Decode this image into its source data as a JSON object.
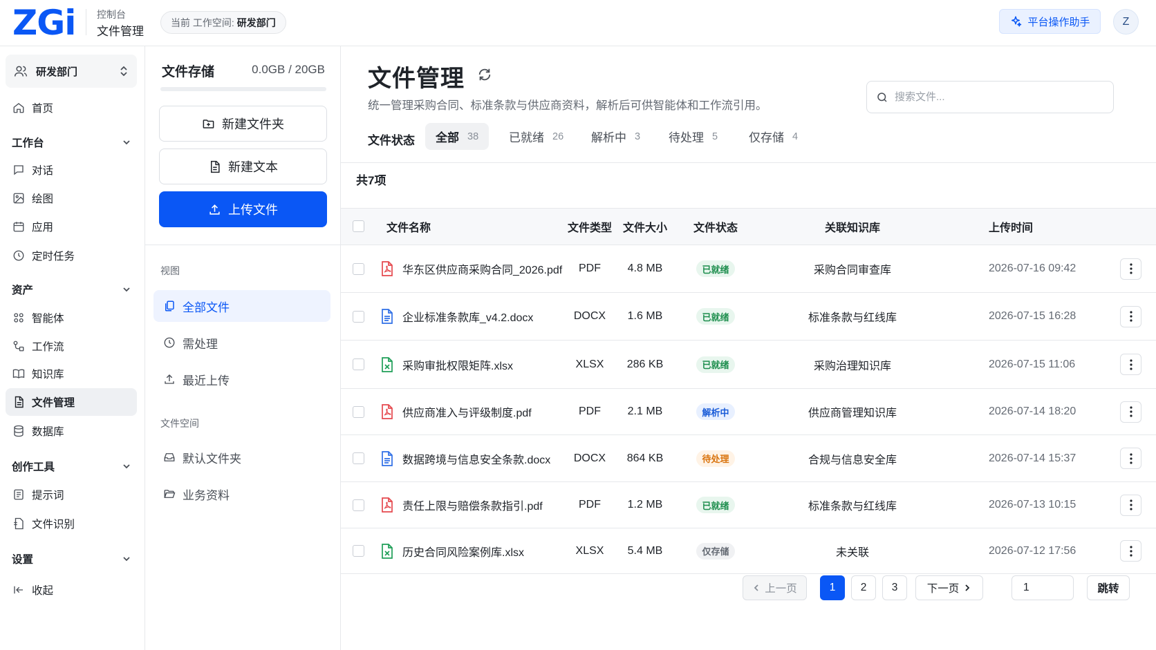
{
  "header": {
    "logo": "ZGi",
    "console_label": "控制台",
    "page_label": "文件管理",
    "workspace_prefix": "当前 工作空间:",
    "workspace_name": "研发部门",
    "assistant_label": "平台操作助手",
    "avatar_initial": "Z",
    "accent": "#0a57f5"
  },
  "nav": {
    "dept": "研发部门",
    "home": "首页",
    "workbench": "工作台",
    "chat": "对话",
    "draw": "绘图",
    "apps": "应用",
    "scheduled": "定时任务",
    "assets": "资产",
    "agents": "智能体",
    "workflow": "工作流",
    "knowledge": "知识库",
    "files": "文件管理",
    "database": "数据库",
    "creator_tools": "创作工具",
    "prompts": "提示词",
    "ocr": "文件识别",
    "settings": "设置",
    "collapse": "收起"
  },
  "panel": {
    "storage_title": "文件存储",
    "storage_usage": "0.0GB / 20GB",
    "storage_used_fraction": 0,
    "new_folder": "新建文件夹",
    "new_text": "新建文本",
    "upload": "上传文件",
    "view_label": "视图",
    "views": [
      "全部文件",
      "需处理",
      "最近上传"
    ],
    "space_label": "文件空间",
    "spaces": [
      "默认文件夹",
      "业务资料"
    ]
  },
  "main": {
    "title": "文件管理",
    "description": "统一管理采购合同、标准条款与供应商资料，解析后可供智能体和工作流引用。",
    "search_placeholder": "搜索文件...",
    "status_label": "文件状态",
    "tabs": [
      {
        "label": "全部",
        "count": "38"
      },
      {
        "label": "已就绪",
        "count": "26"
      },
      {
        "label": "解析中",
        "count": "3"
      },
      {
        "label": "待处理",
        "count": "5"
      },
      {
        "label": "仅存储",
        "count": "4"
      }
    ],
    "total": "共7项",
    "columns": [
      "文件名称",
      "文件类型",
      "文件大小",
      "文件状态",
      "关联知识库",
      "上传时间"
    ],
    "rows": [
      {
        "name": "华东区供应商采购合同_2026.pdf",
        "type": "PDF",
        "size": "4.8 MB",
        "status": "已就绪",
        "kb": "采购合同审查库",
        "time": "2026-07-16 09:42",
        "icon": "pdf-icon"
      },
      {
        "name": "企业标准条款库_v4.2.docx",
        "type": "DOCX",
        "size": "1.6 MB",
        "status": "已就绪",
        "kb": "标准条款与红线库",
        "time": "2026-07-15 16:28",
        "icon": "docx-icon"
      },
      {
        "name": "采购审批权限矩阵.xlsx",
        "type": "XLSX",
        "size": "286 KB",
        "status": "已就绪",
        "kb": "采购治理知识库",
        "time": "2026-07-15 11:06",
        "icon": "xlsx-icon"
      },
      {
        "name": "供应商准入与评级制度.pdf",
        "type": "PDF",
        "size": "2.1 MB",
        "status": "解析中",
        "kb": "供应商管理知识库",
        "time": "2026-07-14 18:20",
        "icon": "pdf-icon"
      },
      {
        "name": "数据跨境与信息安全条款.docx",
        "type": "DOCX",
        "size": "864 KB",
        "status": "待处理",
        "kb": "合规与信息安全库",
        "time": "2026-07-14 15:37",
        "icon": "docx-icon"
      },
      {
        "name": "责任上限与赔偿条款指引.pdf",
        "type": "PDF",
        "size": "1.2 MB",
        "status": "已就绪",
        "kb": "标准条款与红线库",
        "time": "2026-07-13 10:15",
        "icon": "pdf-icon"
      },
      {
        "name": "历史合同风险案例库.xlsx",
        "type": "XLSX",
        "size": "5.4 MB",
        "status": "仅存储",
        "kb": "未关联",
        "time": "2026-07-12 17:56",
        "icon": "xlsx-icon"
      }
    ],
    "pager": {
      "prev": "上一页",
      "pages": [
        "1",
        "2",
        "3"
      ],
      "current": "1",
      "next": "下一页",
      "jump_value": "1",
      "jump": "跳转"
    }
  }
}
